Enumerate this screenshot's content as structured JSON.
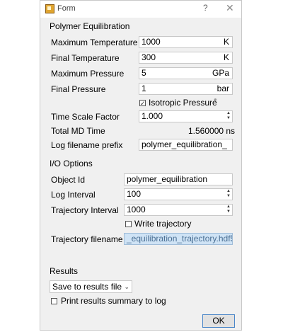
{
  "window": {
    "title": "Form",
    "help": "?",
    "close": "✕"
  },
  "polymer": {
    "section": "Polymer Equilibration",
    "max_temp": {
      "label": "Maximum Temperature",
      "value": "1000",
      "unit": "K"
    },
    "final_temp": {
      "label": "Final Temperature",
      "value": "300",
      "unit": "K"
    },
    "max_pressure": {
      "label": "Maximum Pressure",
      "value": "5",
      "unit": "GPa"
    },
    "final_pressure": {
      "label": "Final Pressure",
      "value": "1",
      "unit": "bar"
    },
    "isotropic": {
      "label": "Isotropic Pressure",
      "checked": true
    },
    "time_scale": {
      "label": "Time Scale Factor",
      "value": "1.000"
    },
    "total_md": {
      "label": "Total MD Time",
      "value": "1.560000 ns"
    },
    "log_prefix": {
      "label": "Log filename prefix",
      "value": "polymer_equilibration_"
    }
  },
  "io": {
    "section": "I/O Options",
    "object_id": {
      "label": "Object Id",
      "value": "polymer_equilibration"
    },
    "log_interval": {
      "label": "Log Interval",
      "value": "100"
    },
    "traj_interval": {
      "label": "Trajectory Interval",
      "value": "1000"
    },
    "write_traj": {
      "label": "Write trajectory",
      "checked": false
    },
    "traj_filename": {
      "label": "Trajectory filename",
      "value": "_equilibration_trajectory.hdf5"
    }
  },
  "results": {
    "section": "Results",
    "select_value": "Save to results file",
    "print_summary": {
      "label": "Print results summary to log",
      "checked": false
    }
  },
  "ok_label": "OK"
}
